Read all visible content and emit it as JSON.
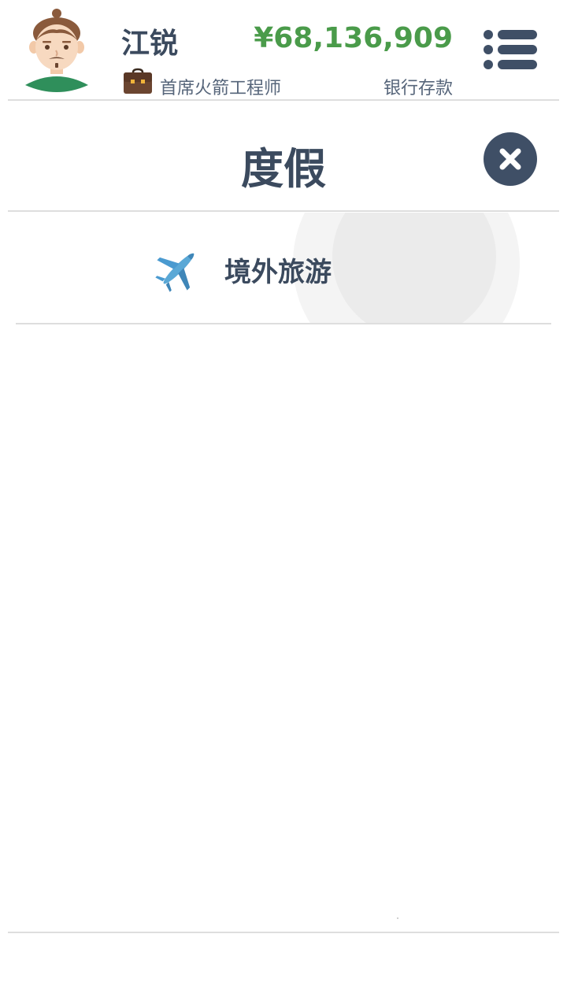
{
  "header": {
    "player_name": "江锐",
    "job_title": "首席火箭工程师",
    "money": "¥68,136,909",
    "money_label": "银行存款",
    "avatar_icon": "avatar-man-icon",
    "job_icon": "briefcase-icon",
    "menu_icon": "list-menu-icon"
  },
  "panel": {
    "title": "度假",
    "close_icon": "close-icon"
  },
  "items": [
    {
      "label": "境外旅游",
      "icon": "airplane-icon"
    }
  ],
  "colors": {
    "text_dark": "#3b4a5e",
    "money_green": "#4a9b4a",
    "close_bg": "#3f4f66",
    "divider": "#dedede"
  }
}
